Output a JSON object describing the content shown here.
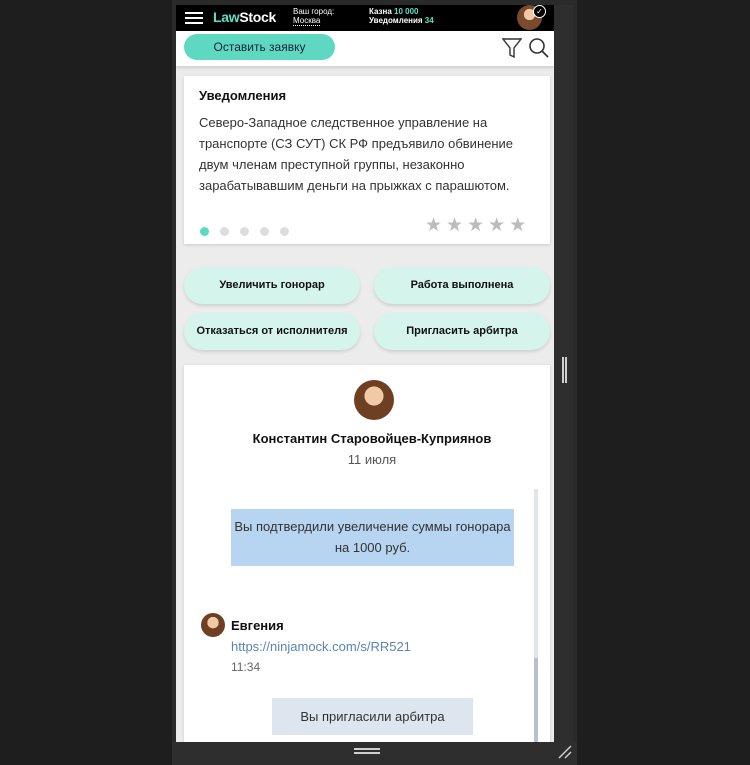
{
  "header": {
    "logo_part1": "Law",
    "logo_part2": "Stock",
    "city_label": "Ваш город:",
    "city_value": "Москва",
    "kazna_label": "Казна",
    "kazna_value": "10 000",
    "notifications_label": "Уведомления",
    "notifications_count": "34"
  },
  "actions": {
    "request_button": "Оставить заявку"
  },
  "notification_card": {
    "title": "Уведомления",
    "text": "Северо-Западное следственное управление на транспорте (СЗ СУТ) СК РФ предъявило обвинение двум членам преступной группы, незаконно зарабатывавшим деньги на прыжках с парашютом.",
    "pager_dots": 5,
    "active_dot": 1,
    "stars_count": 5
  },
  "buttons": {
    "increase_fee": "Увеличить гонорар",
    "work_done": "Работа выполнена",
    "refuse_executor": "Отказаться от исполнителя",
    "invite_arbiter": "Пригласить арбитра"
  },
  "chat": {
    "contact_name": "Константин Старовойцев-Куприянов",
    "date": "11 июля",
    "system_message_1": "Вы подтвердили увеличение суммы гонорара на 1000 руб.",
    "sender_name": "Евгения",
    "link": "https://ninjamock.com/s/RR521",
    "time": "11:34",
    "system_message_2": "Вы пригласили арбитра"
  },
  "colors": {
    "accent": "#5fd8c1",
    "button_bg": "#d5f4ec",
    "message_blue": "#b7d5f0",
    "message_gray": "#dde5ee",
    "link": "#5a84b3"
  }
}
